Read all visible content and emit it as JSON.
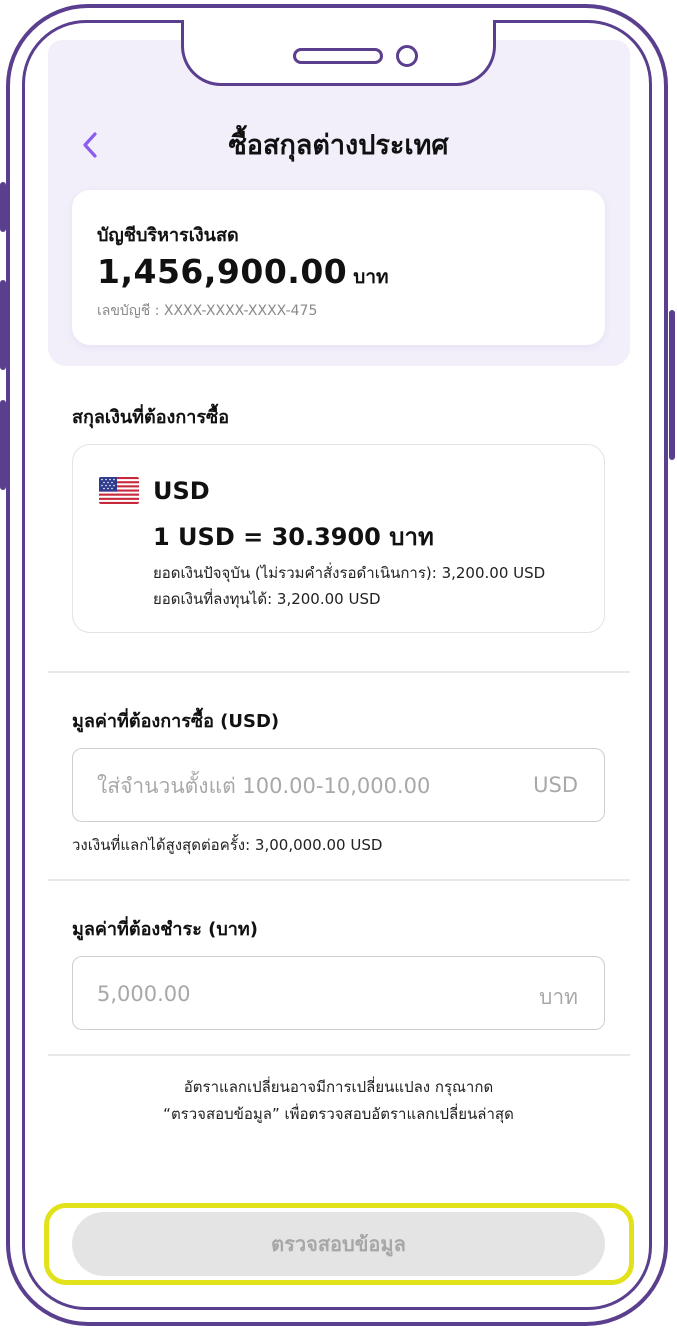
{
  "header": {
    "title": "ซื้อสกุลต่างประเทศ",
    "back_icon": "chevron-left-icon"
  },
  "account": {
    "label": "บัญชีบริหารเงินสด",
    "balance": "1,456,900.00",
    "balance_unit": "บาท",
    "number": "เลขบัญชี : XXXX-XXXX-XXXX-475"
  },
  "currency_section": {
    "label": "สกุลเงินที่ต้องการซื้อ",
    "flag_icon": "us-flag-icon",
    "code": "USD",
    "rate": "1 USD = 30.3900 บาท",
    "current_balance": "ยอดเงินปัจจุบัน (ไม่รวมคำสั่งรอดำเนินการ): 3,200.00 USD",
    "investable_balance": "ยอดเงินที่ลงทุนได้: 3,200.00 USD"
  },
  "buy_amount": {
    "label": "มูลค่าที่ต้องการซื้อ (USD)",
    "placeholder": "ใส่จำนวนตั้งแต่ 100.00-10,000.00",
    "value": "",
    "suffix": "USD",
    "helper": "วงเงินที่แลกได้สูงสุดต่อครั้ง: 3,00,000.00 USD"
  },
  "pay_amount": {
    "label": "มูลค่าที่ต้องชำระ (บาท)",
    "placeholder": "5,000.00",
    "value": "",
    "suffix": "บาท"
  },
  "notice": {
    "line1": "อัตราแลกเปลี่ยนอาจมีการเปลี่ยนแปลง กรุณากด",
    "line2": "“ตรวจสอบข้อมูล” เพื่อตรวจสอบอัตราแลกเปลี่ยนล่าสุด"
  },
  "submit": {
    "label": "ตรวจสอบข้อมูล"
  },
  "colors": {
    "frame": "#5a3f8e",
    "accent": "#8a5cf0",
    "header_bg": "#f2effa",
    "highlight": "#e2e21a",
    "button_disabled_bg": "#e4e4e4",
    "button_disabled_text": "#a7a7a7"
  }
}
